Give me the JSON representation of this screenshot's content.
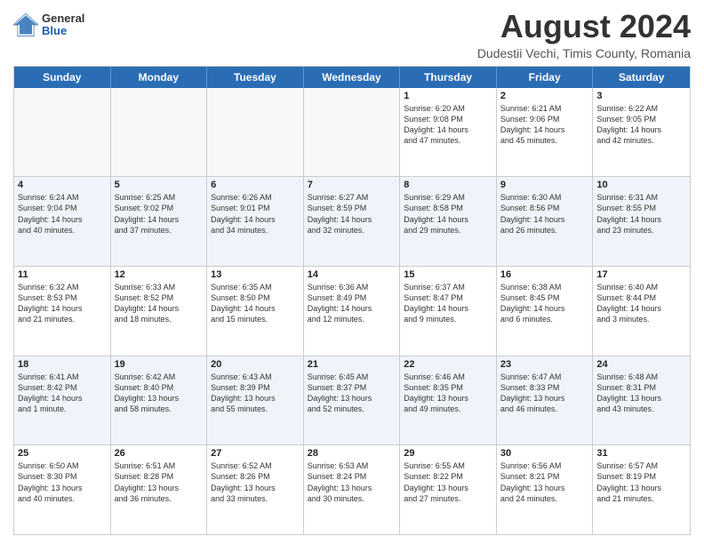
{
  "header": {
    "logo": {
      "general": "General",
      "blue": "Blue"
    },
    "title": "August 2024",
    "location": "Dudestii Vechi, Timis County, Romania"
  },
  "calendar": {
    "days_of_week": [
      "Sunday",
      "Monday",
      "Tuesday",
      "Wednesday",
      "Thursday",
      "Friday",
      "Saturday"
    ],
    "rows": [
      [
        {
          "day": "",
          "info": "",
          "empty": true
        },
        {
          "day": "",
          "info": "",
          "empty": true
        },
        {
          "day": "",
          "info": "",
          "empty": true
        },
        {
          "day": "",
          "info": "",
          "empty": true
        },
        {
          "day": "1",
          "info": "Sunrise: 6:20 AM\nSunset: 9:08 PM\nDaylight: 14 hours\nand 47 minutes.",
          "empty": false
        },
        {
          "day": "2",
          "info": "Sunrise: 6:21 AM\nSunset: 9:06 PM\nDaylight: 14 hours\nand 45 minutes.",
          "empty": false
        },
        {
          "day": "3",
          "info": "Sunrise: 6:22 AM\nSunset: 9:05 PM\nDaylight: 14 hours\nand 42 minutes.",
          "empty": false
        }
      ],
      [
        {
          "day": "4",
          "info": "Sunrise: 6:24 AM\nSunset: 9:04 PM\nDaylight: 14 hours\nand 40 minutes.",
          "empty": false
        },
        {
          "day": "5",
          "info": "Sunrise: 6:25 AM\nSunset: 9:02 PM\nDaylight: 14 hours\nand 37 minutes.",
          "empty": false
        },
        {
          "day": "6",
          "info": "Sunrise: 6:26 AM\nSunset: 9:01 PM\nDaylight: 14 hours\nand 34 minutes.",
          "empty": false
        },
        {
          "day": "7",
          "info": "Sunrise: 6:27 AM\nSunset: 8:59 PM\nDaylight: 14 hours\nand 32 minutes.",
          "empty": false
        },
        {
          "day": "8",
          "info": "Sunrise: 6:29 AM\nSunset: 8:58 PM\nDaylight: 14 hours\nand 29 minutes.",
          "empty": false
        },
        {
          "day": "9",
          "info": "Sunrise: 6:30 AM\nSunset: 8:56 PM\nDaylight: 14 hours\nand 26 minutes.",
          "empty": false
        },
        {
          "day": "10",
          "info": "Sunrise: 6:31 AM\nSunset: 8:55 PM\nDaylight: 14 hours\nand 23 minutes.",
          "empty": false
        }
      ],
      [
        {
          "day": "11",
          "info": "Sunrise: 6:32 AM\nSunset: 8:53 PM\nDaylight: 14 hours\nand 21 minutes.",
          "empty": false
        },
        {
          "day": "12",
          "info": "Sunrise: 6:33 AM\nSunset: 8:52 PM\nDaylight: 14 hours\nand 18 minutes.",
          "empty": false
        },
        {
          "day": "13",
          "info": "Sunrise: 6:35 AM\nSunset: 8:50 PM\nDaylight: 14 hours\nand 15 minutes.",
          "empty": false
        },
        {
          "day": "14",
          "info": "Sunrise: 6:36 AM\nSunset: 8:49 PM\nDaylight: 14 hours\nand 12 minutes.",
          "empty": false
        },
        {
          "day": "15",
          "info": "Sunrise: 6:37 AM\nSunset: 8:47 PM\nDaylight: 14 hours\nand 9 minutes.",
          "empty": false
        },
        {
          "day": "16",
          "info": "Sunrise: 6:38 AM\nSunset: 8:45 PM\nDaylight: 14 hours\nand 6 minutes.",
          "empty": false
        },
        {
          "day": "17",
          "info": "Sunrise: 6:40 AM\nSunset: 8:44 PM\nDaylight: 14 hours\nand 3 minutes.",
          "empty": false
        }
      ],
      [
        {
          "day": "18",
          "info": "Sunrise: 6:41 AM\nSunset: 8:42 PM\nDaylight: 14 hours\nand 1 minute.",
          "empty": false
        },
        {
          "day": "19",
          "info": "Sunrise: 6:42 AM\nSunset: 8:40 PM\nDaylight: 13 hours\nand 58 minutes.",
          "empty": false
        },
        {
          "day": "20",
          "info": "Sunrise: 6:43 AM\nSunset: 8:39 PM\nDaylight: 13 hours\nand 55 minutes.",
          "empty": false
        },
        {
          "day": "21",
          "info": "Sunrise: 6:45 AM\nSunset: 8:37 PM\nDaylight: 13 hours\nand 52 minutes.",
          "empty": false
        },
        {
          "day": "22",
          "info": "Sunrise: 6:46 AM\nSunset: 8:35 PM\nDaylight: 13 hours\nand 49 minutes.",
          "empty": false
        },
        {
          "day": "23",
          "info": "Sunrise: 6:47 AM\nSunset: 8:33 PM\nDaylight: 13 hours\nand 46 minutes.",
          "empty": false
        },
        {
          "day": "24",
          "info": "Sunrise: 6:48 AM\nSunset: 8:31 PM\nDaylight: 13 hours\nand 43 minutes.",
          "empty": false
        }
      ],
      [
        {
          "day": "25",
          "info": "Sunrise: 6:50 AM\nSunset: 8:30 PM\nDaylight: 13 hours\nand 40 minutes.",
          "empty": false
        },
        {
          "day": "26",
          "info": "Sunrise: 6:51 AM\nSunset: 8:28 PM\nDaylight: 13 hours\nand 36 minutes.",
          "empty": false
        },
        {
          "day": "27",
          "info": "Sunrise: 6:52 AM\nSunset: 8:26 PM\nDaylight: 13 hours\nand 33 minutes.",
          "empty": false
        },
        {
          "day": "28",
          "info": "Sunrise: 6:53 AM\nSunset: 8:24 PM\nDaylight: 13 hours\nand 30 minutes.",
          "empty": false
        },
        {
          "day": "29",
          "info": "Sunrise: 6:55 AM\nSunset: 8:22 PM\nDaylight: 13 hours\nand 27 minutes.",
          "empty": false
        },
        {
          "day": "30",
          "info": "Sunrise: 6:56 AM\nSunset: 8:21 PM\nDaylight: 13 hours\nand 24 minutes.",
          "empty": false
        },
        {
          "day": "31",
          "info": "Sunrise: 6:57 AM\nSunset: 8:19 PM\nDaylight: 13 hours\nand 21 minutes.",
          "empty": false
        }
      ]
    ]
  }
}
